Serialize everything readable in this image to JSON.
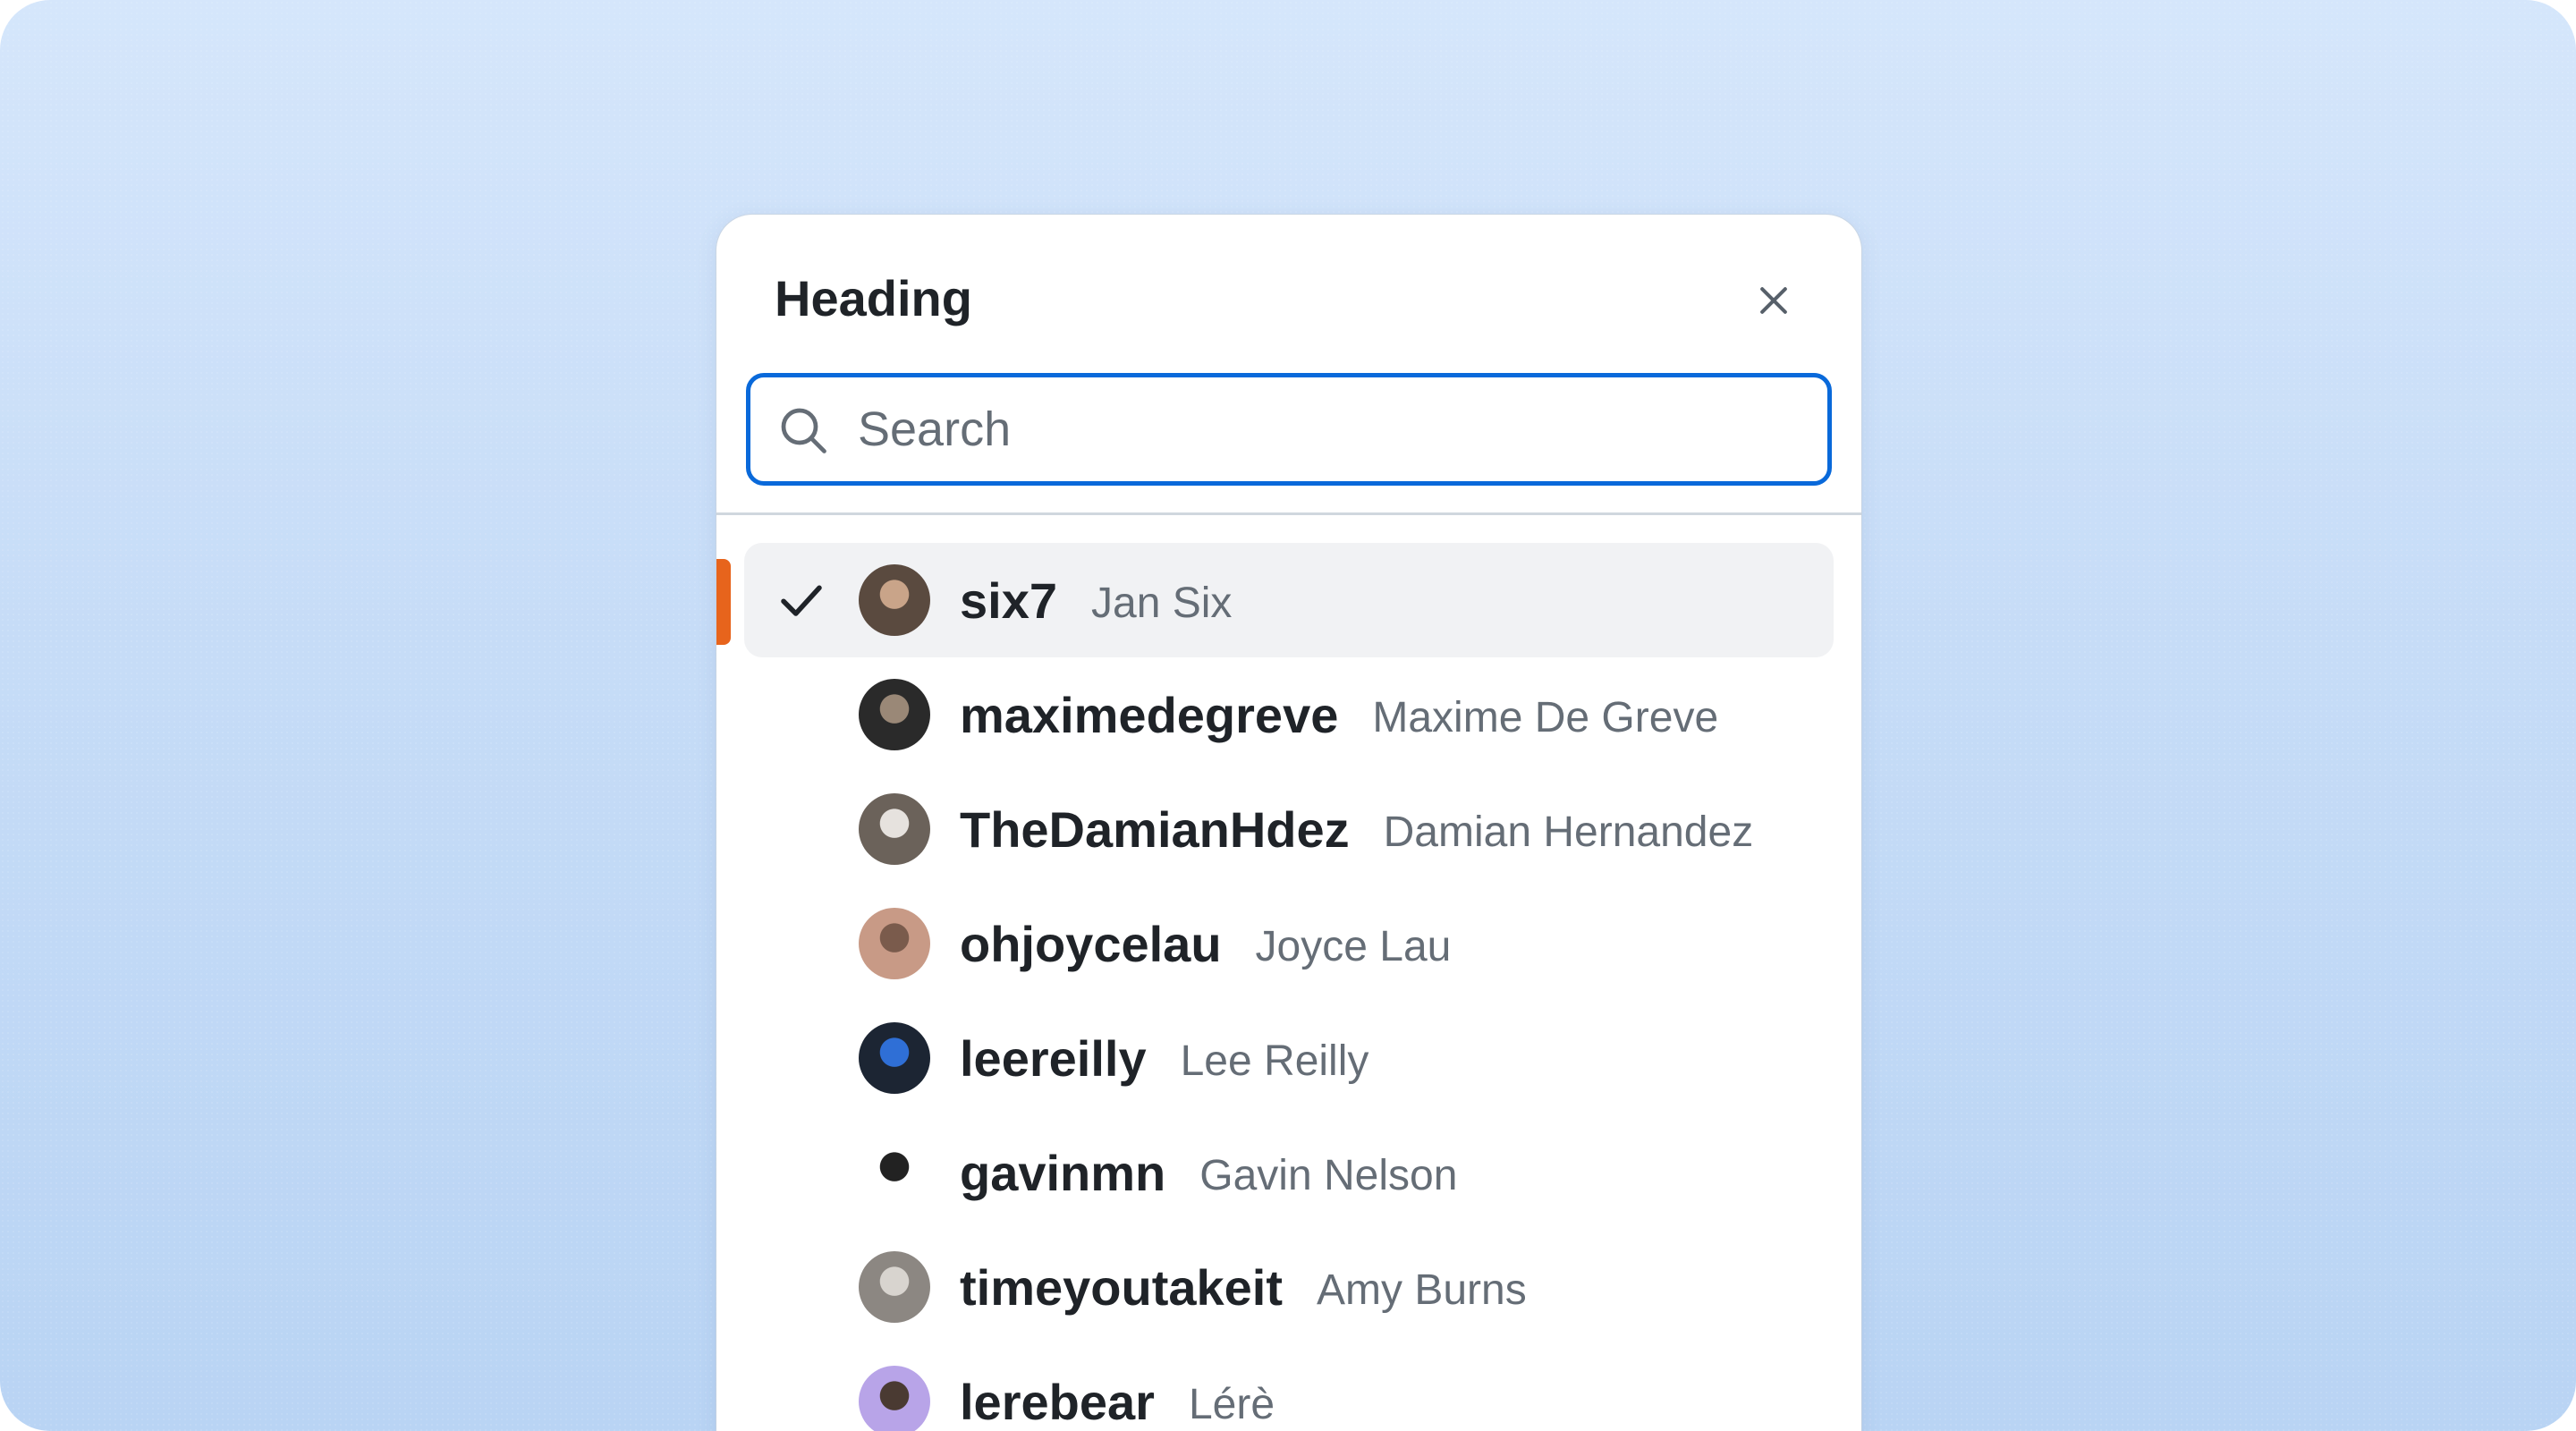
{
  "panel": {
    "heading": "Heading",
    "close_label": "Close",
    "search": {
      "placeholder": "Search",
      "value": ""
    }
  },
  "users": [
    {
      "username": "six7",
      "name": "Jan Six",
      "selected": true,
      "avatar_colors": [
        "#5a4a3f",
        "#c9a489"
      ]
    },
    {
      "username": "maximedegreve",
      "name": "Maxime De Greve",
      "selected": false,
      "avatar_colors": [
        "#2a2a2a",
        "#9a8877"
      ]
    },
    {
      "username": "TheDamianHdez",
      "name": "Damian Hernandez",
      "selected": false,
      "avatar_colors": [
        "#6b625a",
        "#e6e2de"
      ]
    },
    {
      "username": "ohjoycelau",
      "name": "Joyce Lau",
      "selected": false,
      "avatar_colors": [
        "#c89a86",
        "#7a5b4c"
      ]
    },
    {
      "username": "leereilly",
      "name": "Lee Reilly",
      "selected": false,
      "avatar_colors": [
        "#1c2533",
        "#2f6fd6"
      ]
    },
    {
      "username": "gavinmn",
      "name": "Gavin Nelson",
      "selected": false,
      "avatar_colors": [
        "#ffffff",
        "#222222"
      ]
    },
    {
      "username": "timeyoutakeit",
      "name": "Amy Burns",
      "selected": false,
      "avatar_colors": [
        "#8c8782",
        "#d8d4cf"
      ]
    },
    {
      "username": "lerebear",
      "name": "Lérè",
      "selected": false,
      "avatar_colors": [
        "#b8a4e8",
        "#4a3a32"
      ]
    }
  ],
  "colors": {
    "accent_blue": "#0969da",
    "active_indicator": "#e7641c",
    "text_primary": "#1f2328",
    "text_secondary": "#656d76"
  },
  "icons": {
    "close": "close-icon",
    "search": "search-icon",
    "check": "check-icon"
  }
}
